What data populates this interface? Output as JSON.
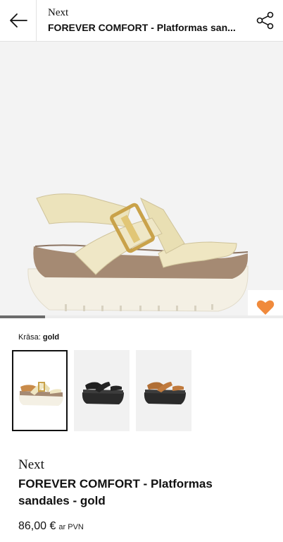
{
  "header": {
    "brand": "Next",
    "title": "FOREVER COMFORT  - Platformas san..."
  },
  "icons": {
    "back": "arrow-left-icon",
    "share": "share-icon",
    "favorite": "heart-icon",
    "bag": "shopping-bag-icon"
  },
  "gallery": {
    "progress": 0.16
  },
  "color": {
    "label": "Krāsa:",
    "value": "gold",
    "options": [
      "gold",
      "black",
      "tan"
    ]
  },
  "product": {
    "brand": "Next",
    "title": "FOREVER COMFORT  - Platformas sandales - gold",
    "price": "86,00 €",
    "vat_note": "ar PVN"
  },
  "colors": {
    "accent": "#f08a3c",
    "bag_bg": "#5a5a5a"
  }
}
